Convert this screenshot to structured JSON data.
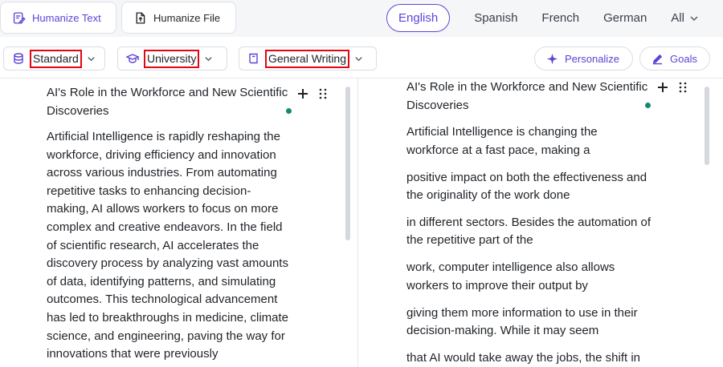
{
  "topbar": {
    "humanize_text_label": "Humanize Text",
    "humanize_file_label": "Humanize File",
    "languages": [
      "English",
      "Spanish",
      "French",
      "German"
    ],
    "active_language": "English",
    "all_label": "All"
  },
  "options": {
    "tone": "Standard",
    "level": "University",
    "purpose": "General Writing",
    "personalize_label": "Personalize",
    "goals_label": "Goals"
  },
  "colors": {
    "accent": "#5b45d6",
    "highlight_box": "#e30613",
    "status_dot": "#138a6e"
  },
  "left_editor": {
    "title": "AI's Role in the Workforce and New Scientific Discoveries",
    "lines": [
      "Artificial Intelligence is rapidly reshaping the",
      "workforce, driving efficiency and innovation",
      "across various industries. From automating",
      "repetitive tasks to enhancing decision-",
      "making, AI allows workers to focus on more",
      "complex and creative endeavors. In the field",
      "of scientific research, AI accelerates the",
      "discovery process by analyzing vast amounts",
      "of data, identifying patterns, and simulating",
      "outcomes. This technological advancement",
      "has led to breakthroughs in medicine, climate",
      "science, and engineering, paving the way for",
      "innovations that were previously"
    ]
  },
  "right_editor": {
    "title": "AI's Role in the Workforce and New Scientific Discoveries",
    "lines": [
      "Artificial Intelligence is changing the",
      "workforce at a fast pace, making a",
      "positive impact on both the effectiveness and",
      "the originality of the work done",
      "in different sectors. Besides the automation of",
      "the repetitive part of the",
      "work, computer intelligence also allows",
      "workers to improve their output by",
      "giving them more information to use in their",
      "decision-making. While it may seem",
      "that AI would take away the jobs, the shift in"
    ]
  }
}
